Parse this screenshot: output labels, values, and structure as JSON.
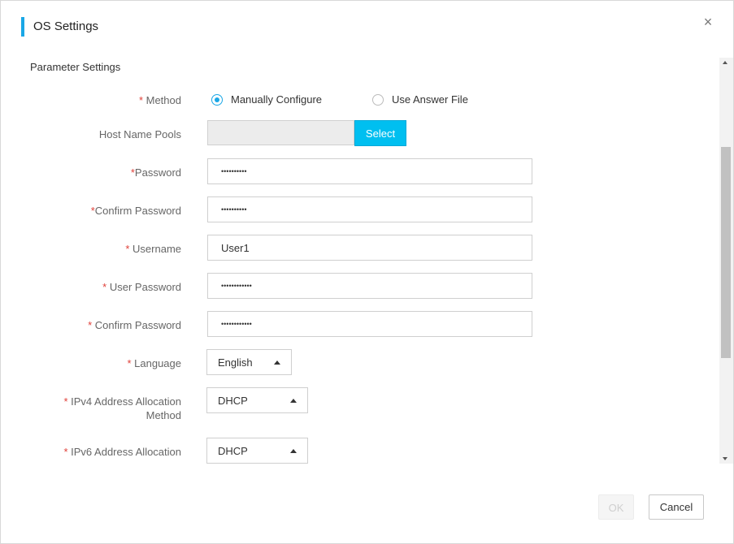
{
  "dialog": {
    "title": "OS Settings",
    "close_symbol": "×"
  },
  "section": {
    "title": "Parameter Settings"
  },
  "required_mark": "*",
  "form": {
    "method": {
      "label": "Method",
      "options": [
        {
          "label": "Manually Configure",
          "checked": true
        },
        {
          "label": "Use Answer File",
          "checked": false
        }
      ]
    },
    "host_name_pools": {
      "label": "Host Name Pools",
      "value": "",
      "button": "Select"
    },
    "password": {
      "label": "Password",
      "value": "••••••••••"
    },
    "confirm_password": {
      "label": "Confirm Password",
      "value": "••••••••••"
    },
    "username": {
      "label": "Username",
      "value": "User1"
    },
    "user_password": {
      "label": "User Password",
      "value": "••••••••••••"
    },
    "user_confirm_password": {
      "label": "Confirm Password",
      "value": "••••••••••••"
    },
    "language": {
      "label": "Language",
      "value": "English"
    },
    "ipv4_allocation": {
      "label": "IPv4 Address Allocation Method",
      "value": "DHCP"
    },
    "ipv6_allocation": {
      "label": "IPv6 Address Allocation",
      "value": "DHCP"
    }
  },
  "footer": {
    "ok": "OK",
    "cancel": "Cancel"
  },
  "colors": {
    "accent": "#1aa7e6",
    "select_button": "#00bff0",
    "required": "#e0413a"
  }
}
